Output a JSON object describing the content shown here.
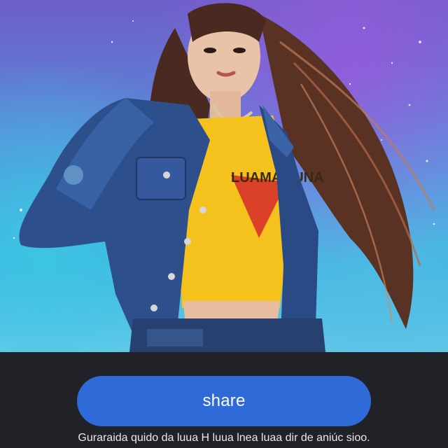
{
  "hero": {
    "icon": "generated-portrait-image",
    "shirt_print": "LUAMA LUNA"
  },
  "actions": {
    "share_label": "share"
  },
  "caption": {
    "text": "Guraraida quido da luua H luua lnea luaa dir de aniúc sioo."
  },
  "colors": {
    "background": "#202228",
    "share_button": "#2f6bd8",
    "caption_text": "#e9e9ec"
  }
}
